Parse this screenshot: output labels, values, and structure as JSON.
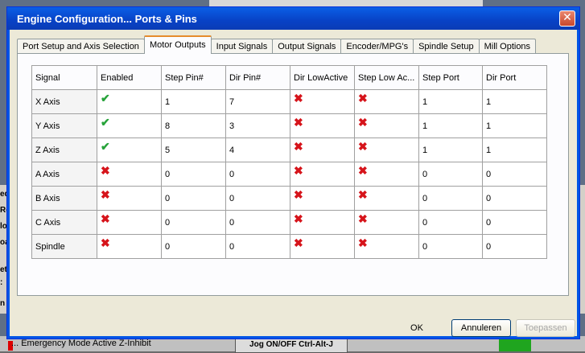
{
  "background": {
    "left_fragments": [
      "ed",
      "Re",
      "lo",
      "oa",
      "et",
      ":",
      "n"
    ],
    "bottom_text": "... Emergency Mode Active Z-Inhibit",
    "jog_button": "Jog ON/OFF Ctrl-Alt-J"
  },
  "dialog": {
    "title": "Engine Configuration... Ports & Pins",
    "tabs": [
      {
        "label": "Port Setup and Axis Selection",
        "active": false
      },
      {
        "label": "Motor Outputs",
        "active": true
      },
      {
        "label": "Input Signals",
        "active": false
      },
      {
        "label": "Output Signals",
        "active": false
      },
      {
        "label": "Encoder/MPG's",
        "active": false
      },
      {
        "label": "Spindle Setup",
        "active": false
      },
      {
        "label": "Mill Options",
        "active": false
      }
    ],
    "table": {
      "headers": [
        "Signal",
        "Enabled",
        "Step Pin#",
        "Dir Pin#",
        "Dir LowActive",
        "Step Low Ac...",
        "Step Port",
        "Dir Port"
      ],
      "rows": [
        {
          "signal": "X Axis",
          "enabled": true,
          "step_pin": "1",
          "dir_pin": "7",
          "dir_low_active": false,
          "step_low_active": false,
          "step_port": "1",
          "dir_port": "1"
        },
        {
          "signal": "Y Axis",
          "enabled": true,
          "step_pin": "8",
          "dir_pin": "3",
          "dir_low_active": false,
          "step_low_active": false,
          "step_port": "1",
          "dir_port": "1"
        },
        {
          "signal": "Z Axis",
          "enabled": true,
          "step_pin": "5",
          "dir_pin": "4",
          "dir_low_active": false,
          "step_low_active": false,
          "step_port": "1",
          "dir_port": "1"
        },
        {
          "signal": "A Axis",
          "enabled": false,
          "step_pin": "0",
          "dir_pin": "0",
          "dir_low_active": false,
          "step_low_active": false,
          "step_port": "0",
          "dir_port": "0"
        },
        {
          "signal": "B Axis",
          "enabled": false,
          "step_pin": "0",
          "dir_pin": "0",
          "dir_low_active": false,
          "step_low_active": false,
          "step_port": "0",
          "dir_port": "0"
        },
        {
          "signal": "C Axis",
          "enabled": false,
          "step_pin": "0",
          "dir_pin": "0",
          "dir_low_active": false,
          "step_low_active": false,
          "step_port": "0",
          "dir_port": "0"
        },
        {
          "signal": "Spindle",
          "enabled": false,
          "step_pin": "0",
          "dir_pin": "0",
          "dir_low_active": false,
          "step_low_active": false,
          "step_port": "0",
          "dir_port": "0"
        }
      ],
      "icons": {
        "true": "✔",
        "false": "✖"
      }
    },
    "buttons": {
      "ok": "OK",
      "cancel": "Annuleren",
      "apply": "Toepassen"
    }
  }
}
